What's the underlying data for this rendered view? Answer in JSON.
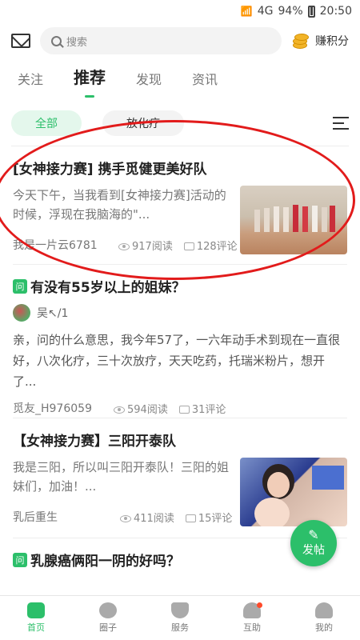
{
  "status": {
    "battery": "94%",
    "time": "20:50",
    "signal": "4G"
  },
  "header": {
    "search_placeholder": "搜索",
    "earn_label": "赚积分"
  },
  "tabs": [
    {
      "label": "关注"
    },
    {
      "label": "推荐"
    },
    {
      "label": "发现"
    },
    {
      "label": "资讯"
    }
  ],
  "chips": [
    {
      "label": "全部"
    },
    {
      "label": "放化疗"
    }
  ],
  "posts": [
    {
      "title": "[女神接力赛] 携手觅健更美好队",
      "excerpt": "今天下午，当我看到[女神接力赛]活动的时候，浮现在我脑海的\"...",
      "author": "我是一片云6781",
      "views": "917阅读",
      "comments": "128评论"
    },
    {
      "question_badge": "问",
      "title": "有没有55岁以上的姐妹？",
      "answerer": "吴↖/1",
      "body": "亲，问的什么意思，我今年57了，一六年动手术到现在一直很好，八次化疗，三十次放疗，天天吃药，托瑞米粉片，想开了...",
      "author": "觅友_H976059",
      "views": "594阅读",
      "comments": "31评论"
    },
    {
      "title": "【女神接力赛】三阳开泰队",
      "excerpt": "我是三阳，所以叫三阳开泰队！三阳的姐妹们，加油！...",
      "author": "乳后重生",
      "views": "411阅读",
      "comments": "15评论"
    },
    {
      "question_badge": "问",
      "title": "乳腺癌俩阳一阴的好吗？"
    }
  ],
  "fab": {
    "label": "发帖"
  },
  "bottom_nav": [
    {
      "label": "首页",
      "icon": "home-icon"
    },
    {
      "label": "圈子",
      "icon": "circle-icon"
    },
    {
      "label": "服务",
      "icon": "service-icon"
    },
    {
      "label": "互助",
      "icon": "mutual-help-icon"
    },
    {
      "label": "我的",
      "icon": "profile-icon"
    }
  ],
  "colors": {
    "accent": "#2cbf6a",
    "annotation": "#e21b1b"
  }
}
